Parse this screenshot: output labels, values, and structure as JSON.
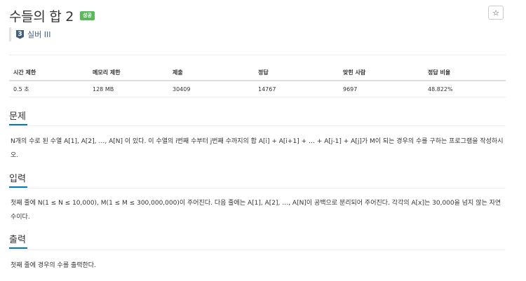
{
  "problem": {
    "title": "수들의 합 2",
    "badge": "성공",
    "star": "☆",
    "tier_number": "3",
    "tier_label": "실버 III"
  },
  "info_table": {
    "headers": [
      "시간 제한",
      "메모리 제한",
      "제출",
      "정답",
      "맞힌 사람",
      "정답 비율"
    ],
    "values": [
      "0.5 초",
      "128 MB",
      "30409",
      "14767",
      "9697",
      "48.822%"
    ]
  },
  "sections": {
    "description": {
      "heading": "문제",
      "text": "N개의 수로 된 수열 A[1], A[2], …, A[N] 이 있다. 이 수열의 i번째 수부터 j번째 수까지의 합 A[i] + A[i+1] + … + A[j-1] + A[j]가 M이 되는 경우의 수를 구하는 프로그램을 작성하시오."
    },
    "input": {
      "heading": "입력",
      "text": "첫째 줄에 N(1 ≤ N ≤ 10,000), M(1 ≤ M ≤ 300,000,000)이 주어진다. 다음 줄에는 A[1], A[2], …, A[N]이 공백으로 분리되어 주어진다. 각각의 A[x]는 30,000을 넘지 않는 자연수이다."
    },
    "output": {
      "heading": "출력",
      "text": "첫째 줄에 경우의 수를 출력한다."
    }
  },
  "colors": {
    "accent": "#0076c0",
    "success_badge": "#5cb85c",
    "tier": "#435f7a"
  }
}
